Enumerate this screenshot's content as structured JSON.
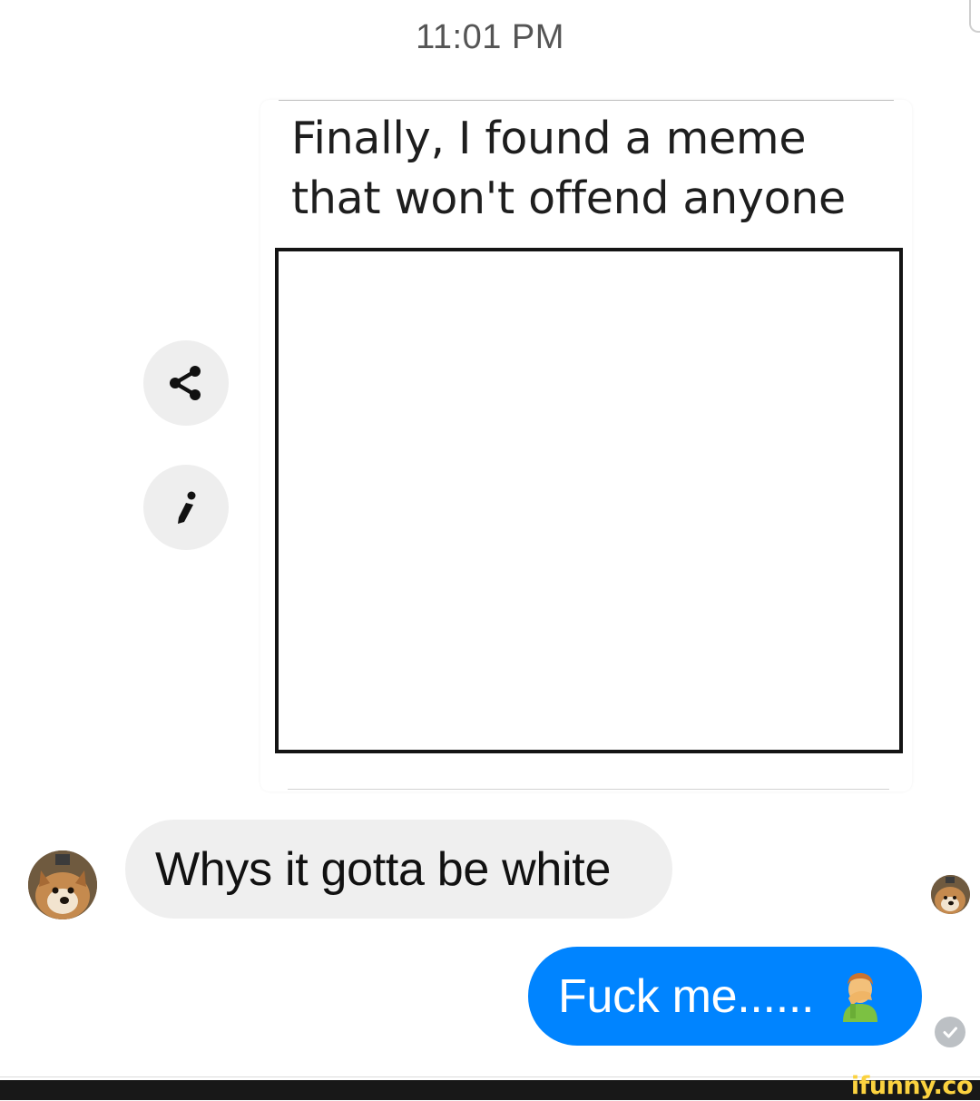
{
  "header": {
    "timestamp": "11:01 PM"
  },
  "meme": {
    "caption": "Finally, I found a meme\nthat won't offend anyone"
  },
  "actions": {
    "share_icon": "share-icon",
    "edit_icon": "pencil-icon"
  },
  "messages": [
    {
      "direction": "incoming",
      "text": "Whys it gotta be white",
      "bubble_color": "#efefef"
    },
    {
      "direction": "outgoing",
      "text": "Fuck me......",
      "emoji": "man-facepalming",
      "bubble_color": "#0084ff"
    }
  ],
  "status": {
    "read_icon": "check-circle-icon"
  },
  "watermark": {
    "text": "ifunny.co",
    "color": "#fbd23f"
  }
}
